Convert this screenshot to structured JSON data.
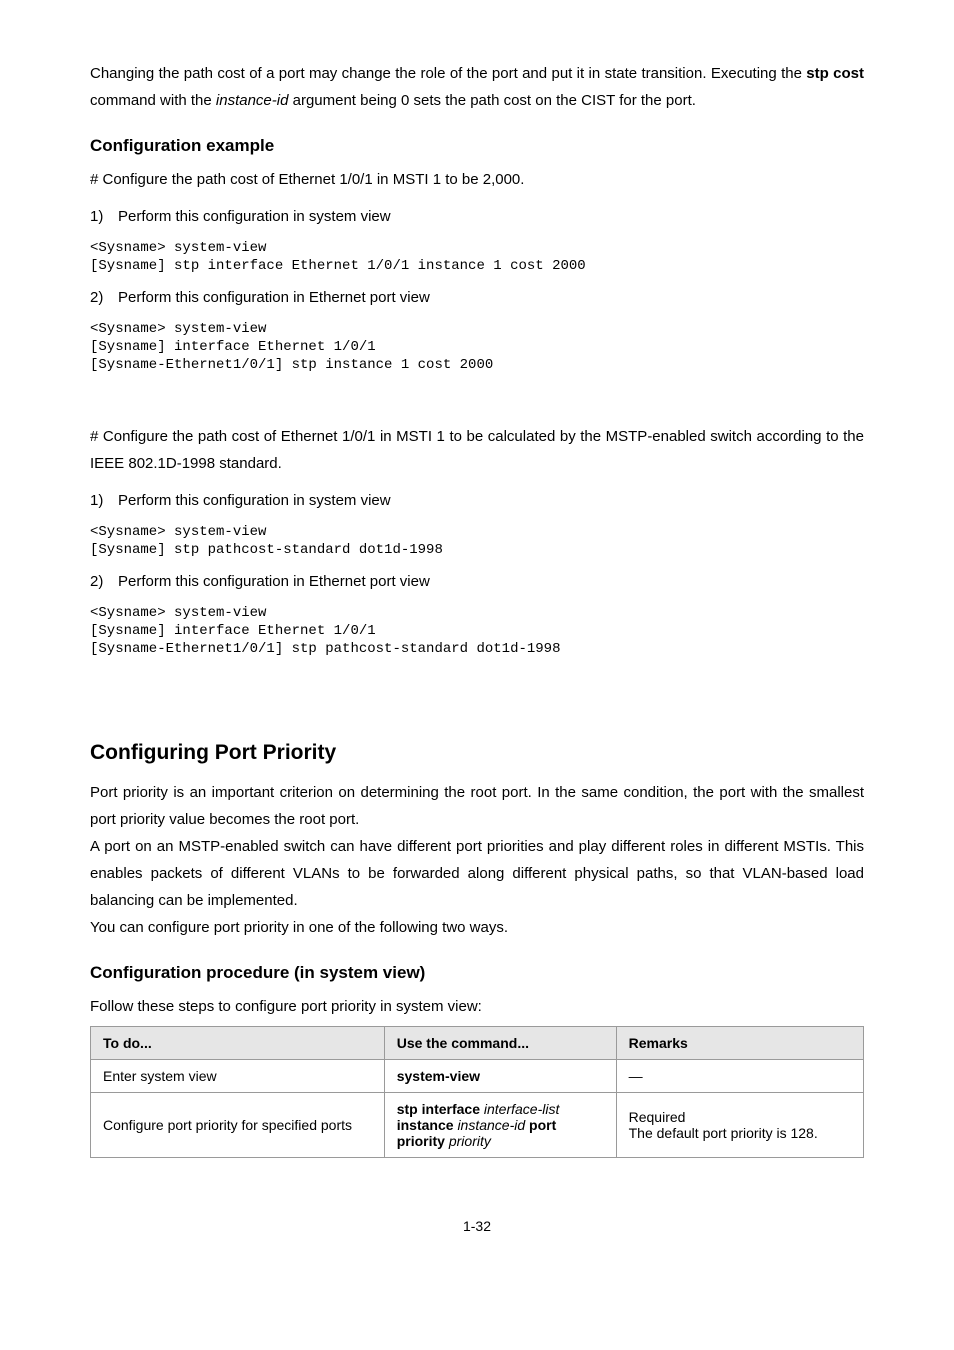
{
  "intro": {
    "p1a": "Changing the path cost of a port may change the role of the port and put it in state transition. Executing the ",
    "p1b": "stp cost",
    "p1c": " command with the ",
    "p1d": "instance-id",
    "p1e": " argument being 0 sets the path cost on the CIST for the port."
  },
  "ex_heading": "Configuration example",
  "ex1_intro": "# Configure the path cost of Ethernet 1/0/1 in MSTI 1 to be 2,000.",
  "num1": "1)",
  "num2": "2)",
  "li_sys": "Perform this configuration in system view",
  "li_eth": "Perform this configuration in Ethernet port view",
  "code": {
    "a": "<Sysname> system-view",
    "b": "[Sysname] stp interface Ethernet 1/0/1 instance 1 cost 2000",
    "c": "[Sysname] interface Ethernet 1/0/1",
    "d": "[Sysname-Ethernet1/0/1] stp instance 1 cost 2000"
  },
  "ex2_intro": "# Configure the path cost of Ethernet 1/0/1 in MSTI 1 to be calculated by the MSTP-enabled switch according to the IEEE 802.1D-1998 standard.",
  "code2": {
    "a": "<Sysname> system-view",
    "b": "[Sysname] stp pathcost-standard dot1d-1998",
    "c": "[Sysname] interface Ethernet 1/0/1",
    "d": "[Sysname-Ethernet1/0/1] stp pathcost-standard dot1d-1998"
  },
  "pp_heading": "Configuring Port Priority",
  "pp_p1": "Port priority is an important criterion on determining the root port. In the same condition, the port with the smallest port priority value becomes the root port.",
  "pp_p2": "A port on an MSTP-enabled switch can have different port priorities and play different roles in different MSTIs. This enables packets of different VLANs to be forwarded along different physical paths, so that VLAN-based load balancing can be implemented.",
  "pp_p3": "You can configure port priority in one of the following two ways.",
  "sys_heading": "Configuration procedure (in system view)",
  "sys_intro": "Follow these steps to configure port priority in system view:",
  "table": {
    "h1": "To do...",
    "h2": "Use the command...",
    "h3": "Remarks",
    "r1c1": "Enter system view",
    "r1c2": "system-view",
    "r1c3": "—",
    "r2c1": "Configure port priority for specified ports",
    "r2c2a": "stp interface ",
    "r2c2b": "interface-list",
    "r2c2c": " instance ",
    "r2c2d": "instance-id",
    "r2c2e": " port priority ",
    "r2c2f": "priority",
    "r2c3a": "Required",
    "r2c3b": "The default port priority is 128."
  },
  "pagenum": "1-32"
}
